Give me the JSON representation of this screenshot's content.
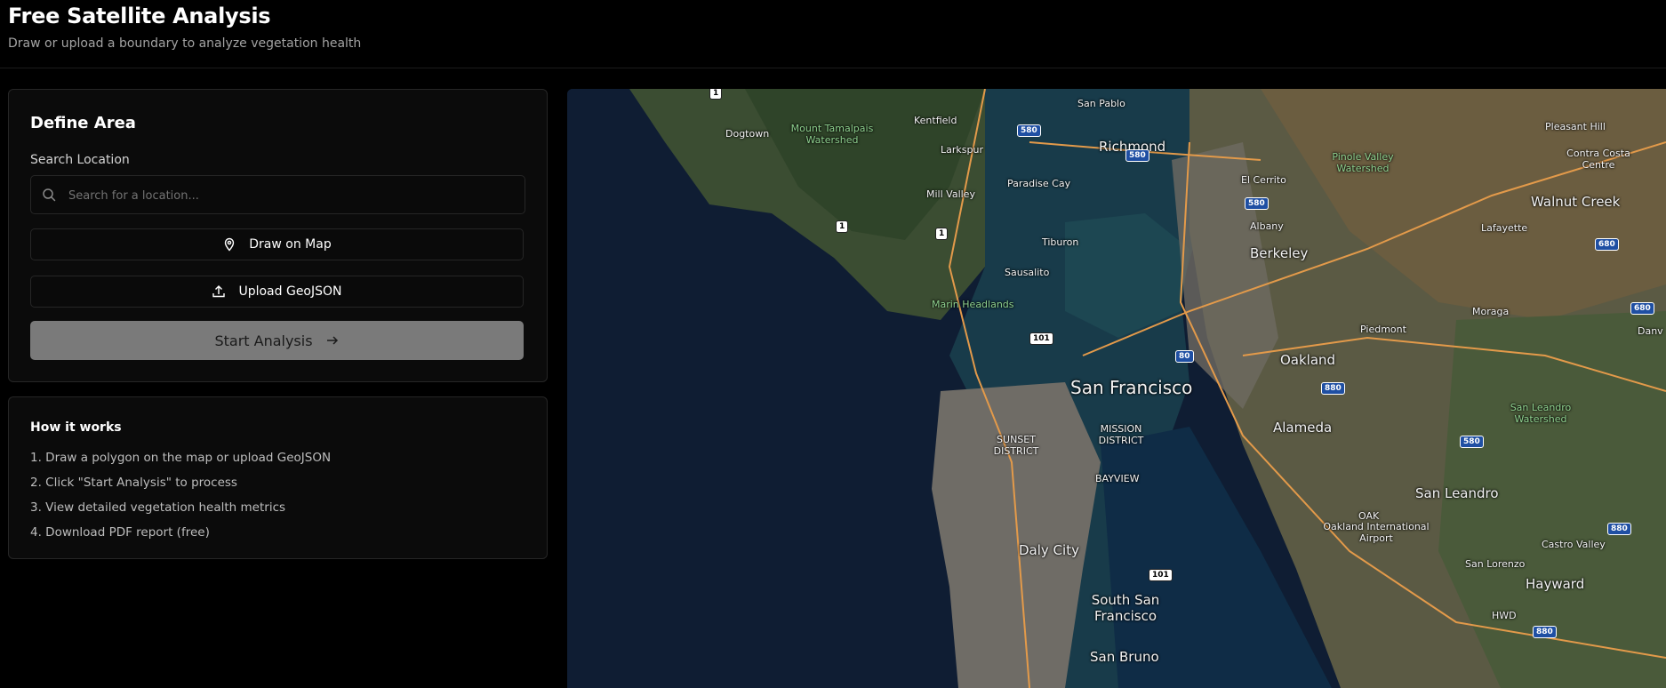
{
  "header": {
    "title": "Free Satellite Analysis",
    "subtitle": "Draw or upload a boundary to analyze vegetation health"
  },
  "define_area": {
    "title": "Define Area",
    "search_label": "Search Location",
    "search_placeholder": "Search for a location...",
    "draw_button": "Draw on Map",
    "upload_button": "Upload GeoJSON",
    "start_button": "Start Analysis"
  },
  "how_it_works": {
    "title": "How it works",
    "steps": [
      "1. Draw a polygon on the map or upload GeoJSON",
      "2. Click \"Start Analysis\" to process",
      "3. View detailed vegetation health metrics",
      "4. Download PDF report (free)"
    ]
  },
  "map": {
    "labels": {
      "san_pablo": "San Pablo",
      "dogtown": "Dogtown",
      "mount_tamalpais": "Mount Tamalpais Watershed",
      "kentfield": "Kentfield",
      "larkspur": "Larkspur",
      "richmond": "Richmond",
      "el_cerrito": "El Cerrito",
      "pinole_valley": "Pinole Valley Watershed",
      "pleasant_hill": "Pleasant Hill",
      "contra_costa": "Contra Costa Centre",
      "walnut_creek": "Walnut Creek",
      "mill_valley": "Mill Valley",
      "paradise_cay": "Paradise Cay",
      "albany": "Albany",
      "lafayette": "Lafayette",
      "tiburon": "Tiburon",
      "berkeley": "Berkeley",
      "sausalito": "Sausalito",
      "marin_headlands": "Marin Headlands",
      "moraga": "Moraga",
      "piedmont": "Piedmont",
      "danville": "Danv",
      "oakland": "Oakland",
      "san_francisco": "San Francisco",
      "mission_district": "MISSION DISTRICT",
      "sunset_district": "SUNSET DISTRICT",
      "alameda": "Alameda",
      "san_leandro_watershed": "San Leandro Watershed",
      "bayview": "BAYVIEW",
      "san_leandro": "San Leandro",
      "oak": "OAK",
      "oakland_airport": "Oakland International Airport",
      "castro_valley": "Castro Valley",
      "daly_city": "Daly City",
      "san_lorenzo": "San Lorenzo",
      "hayward": "Hayward",
      "hwd": "HWD",
      "south_sf": "South San Francisco",
      "san_bruno": "San Bruno"
    },
    "shields": [
      "1",
      "580",
      "580",
      "580",
      "1",
      "1",
      "680",
      "680",
      "101",
      "80",
      "880",
      "580",
      "101",
      "880",
      "880"
    ]
  }
}
